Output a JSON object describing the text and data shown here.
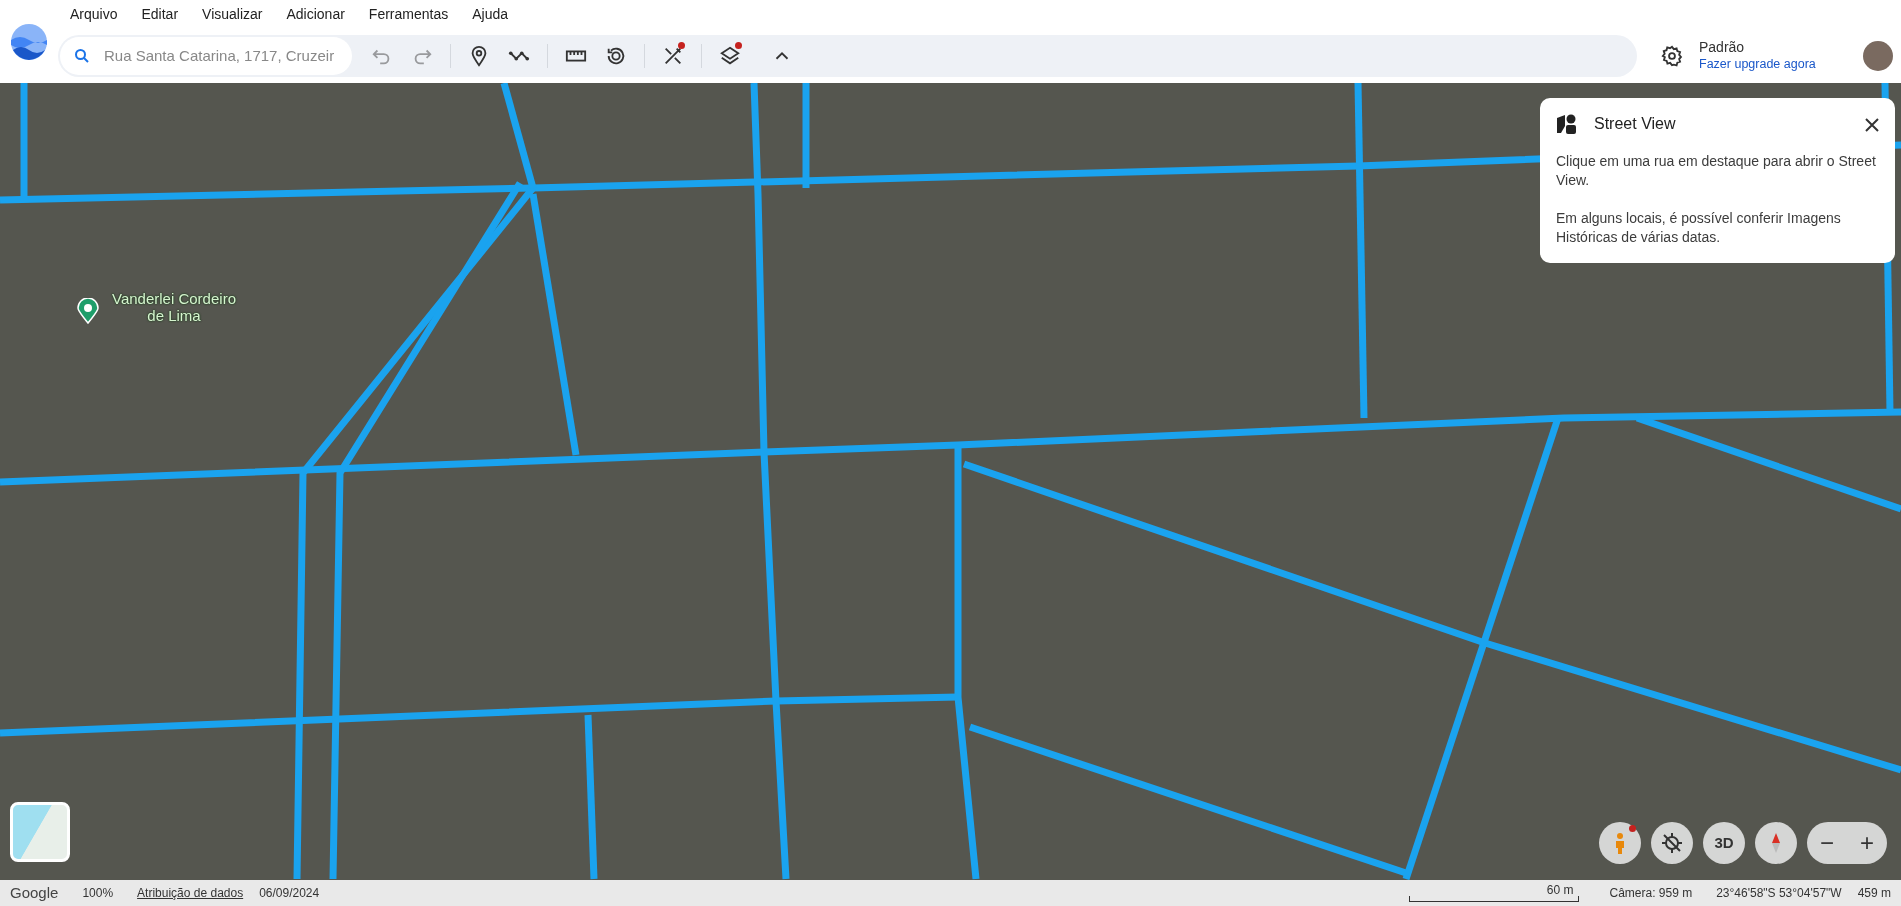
{
  "menu": [
    "Arquivo",
    "Editar",
    "Visualizar",
    "Adicionar",
    "Ferramentas",
    "Ajuda"
  ],
  "search": {
    "value": "Rua Santa Catarina, 1717, Cruzeir"
  },
  "toolbar": [
    [
      {
        "kind": "undo",
        "disabled": true,
        "badge": false
      },
      {
        "kind": "redo",
        "disabled": true,
        "badge": false
      }
    ],
    [
      {
        "kind": "pin",
        "disabled": false,
        "badge": false
      },
      {
        "kind": "path",
        "disabled": false,
        "badge": false
      }
    ],
    [
      {
        "kind": "ruler",
        "disabled": false,
        "badge": false
      },
      {
        "kind": "history",
        "disabled": false,
        "badge": false
      }
    ],
    [
      {
        "kind": "tools",
        "disabled": false,
        "badge": true
      }
    ],
    [
      {
        "kind": "layers",
        "disabled": false,
        "badge": true
      }
    ],
    [
      {
        "kind": "caret",
        "disabled": false,
        "badge": false
      }
    ]
  ],
  "account": {
    "plan": "Padrão",
    "upgrade_link": "Fazer upgrade agora"
  },
  "place_label": "Vanderlei Cordeiro de Lima",
  "street_view_panel": {
    "title": "Street View",
    "paragraphs": [
      "Clique em uma rua em destaque para abrir o Street View.",
      "Em alguns locais, é possível conferir Imagens Históricas de várias datas."
    ]
  },
  "map_controls": [
    {
      "kind": "pegman",
      "badge": true
    },
    {
      "kind": "recenter",
      "badge": false
    },
    {
      "kind": "text",
      "label": "3D",
      "badge": false
    },
    {
      "kind": "compass",
      "badge": false
    }
  ],
  "zoom": {
    "out": "−",
    "in": "+"
  },
  "status_bar": {
    "brand": "Google",
    "zoom": "100%",
    "attribution_link": "Atribuição de dados",
    "date": "06/09/2024",
    "scale": "60 m",
    "camera": "Câmera: 959 m",
    "coordinates": "23°46'58\"S 53°04'57\"W",
    "elevation": "459 m"
  }
}
